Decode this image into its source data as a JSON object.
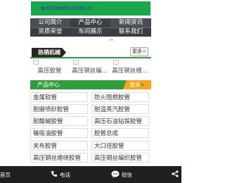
{
  "header": {
    "logo_text": "衡水浩海橡塑技术有限公司"
  },
  "nav": {
    "items": [
      {
        "label": "公司简介"
      },
      {
        "label": "产品中心"
      },
      {
        "label": "新闻资讯"
      },
      {
        "label": "资质荣誉"
      },
      {
        "label": "车间展示"
      },
      {
        "label": "联系我们"
      }
    ]
  },
  "hot_section": {
    "title": "热销机械",
    "more_label": "更多",
    "more_arrow": "+",
    "items": [
      {
        "label": "高压胶管"
      },
      {
        "label": "高压钢丝编..."
      },
      {
        "label": "高压钢丝缠..."
      }
    ]
  },
  "product_section": {
    "title": "产品中心",
    "more_label": "更多",
    "more_arrow": "+",
    "items": [
      {
        "label": "金属软管"
      },
      {
        "label": "防火阻燃胶管"
      },
      {
        "label": "耐磨喷砂胶管"
      },
      {
        "label": "耐温蒸汽胶管"
      },
      {
        "label": "耐酸碱胶管"
      },
      {
        "label": "高压石油钻探胶管"
      },
      {
        "label": "输吸油胶管"
      },
      {
        "label": "胶管总成"
      },
      {
        "label": "夹布胶管"
      },
      {
        "label": "大口径胶管"
      },
      {
        "label": "高压钢丝缠绕胶管"
      },
      {
        "label": "高压钢丝编织胶管"
      }
    ]
  },
  "bottom_bar": {
    "home_label": "首页",
    "call_label": "电话",
    "message_label": "短信",
    "share_label": ""
  }
}
